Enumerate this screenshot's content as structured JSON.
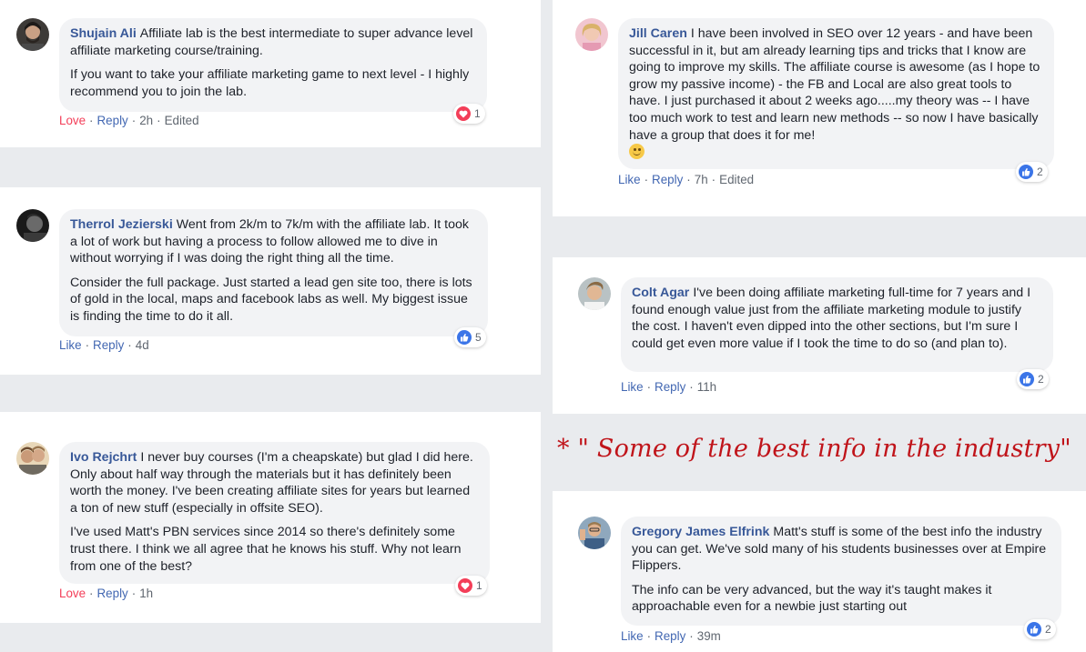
{
  "colors": {
    "author": "#385898",
    "action_link": "#4267b2",
    "love": "#f33e58",
    "like_badge": "#3b75e8",
    "bubble_bg": "#f2f3f5",
    "quote": "#c0141a"
  },
  "comments": [
    {
      "author": "Shujain Ali",
      "text": [
        "Affiliate lab is the best intermediate to super advance level affiliate marketing course/training.",
        "If you want to take your affiliate marketing game to next level - I highly recommend you to join the lab."
      ],
      "action": "Love",
      "reply": "Reply",
      "time": "2h",
      "edited": "Edited",
      "reaction": {
        "icon": "heart-icon",
        "count": "1"
      }
    },
    {
      "author": "Therrol Jezierski",
      "text": [
        "Went from 2k/m to 7k/m with the affiliate lab. It took a lot of work but having a process to follow allowed me to dive in without worrying if I was doing the right thing all the time.",
        "Consider the full package. Just started a lead gen site too, there is lots of gold in the local, maps and facebook labs as well. My biggest issue is finding the time to do it all."
      ],
      "action": "Like",
      "reply": "Reply",
      "time": "4d",
      "reaction": {
        "icon": "thumbs-up-icon",
        "count": "5"
      }
    },
    {
      "author": "Ivo Rejchrt",
      "text": [
        "I never buy courses (I'm a cheapskate) but glad I did here. Only about half way through the materials but it has definitely been worth the money. I've been creating affiliate sites for years but learned a ton of new stuff (especially in offsite SEO).",
        "I've used Matt's PBN services since 2014 so there's definitely some trust there. I think we all agree that he knows his stuff. Why not learn from one of the best?"
      ],
      "action": "Love",
      "reply": "Reply",
      "time": "1h",
      "reaction": {
        "icon": "heart-icon",
        "count": "1"
      }
    },
    {
      "author": "Jill Caren",
      "text": [
        "I have been involved in SEO over 12 years - and have been successful in it, but am already learning tips and tricks that I know are going to improve my skills. The affiliate course is awesome (as I hope to grow my passive income) - the FB and Local are also great tools to have. I just purchased it about 2 weeks ago.....my theory was -- I have too much work to test and learn new methods -- so now I have basically have a group that does it for me!"
      ],
      "emoji": "smiley-icon",
      "action": "Like",
      "reply": "Reply",
      "time": "7h",
      "edited": "Edited",
      "reaction": {
        "icon": "thumbs-up-icon",
        "count": "2"
      }
    },
    {
      "author": "Colt Agar",
      "text": [
        "I've been doing affiliate marketing full-time for 7 years and I found enough value just from the affiliate marketing module to justify the cost. I haven't even dipped into the other sections, but I'm sure I could get even more value if I took the time to do so (and plan to)."
      ],
      "action": "Like",
      "reply": "Reply",
      "time": "11h",
      "reaction": {
        "icon": "thumbs-up-icon",
        "count": "2"
      }
    },
    {
      "author": "Gregory James Elfrink",
      "text": [
        "Matt's stuff is some of the best info the industry you can get. We've sold many of his students businesses over at Empire Flippers.",
        "The info can be very advanced, but the way it's taught makes it approachable even for a newbie just starting out"
      ],
      "action": "Like",
      "reply": "Reply",
      "time": "39m",
      "reaction": {
        "icon": "thumbs-up-icon",
        "count": "2"
      }
    }
  ],
  "quote": "* \" Some of the best info in the industry\""
}
